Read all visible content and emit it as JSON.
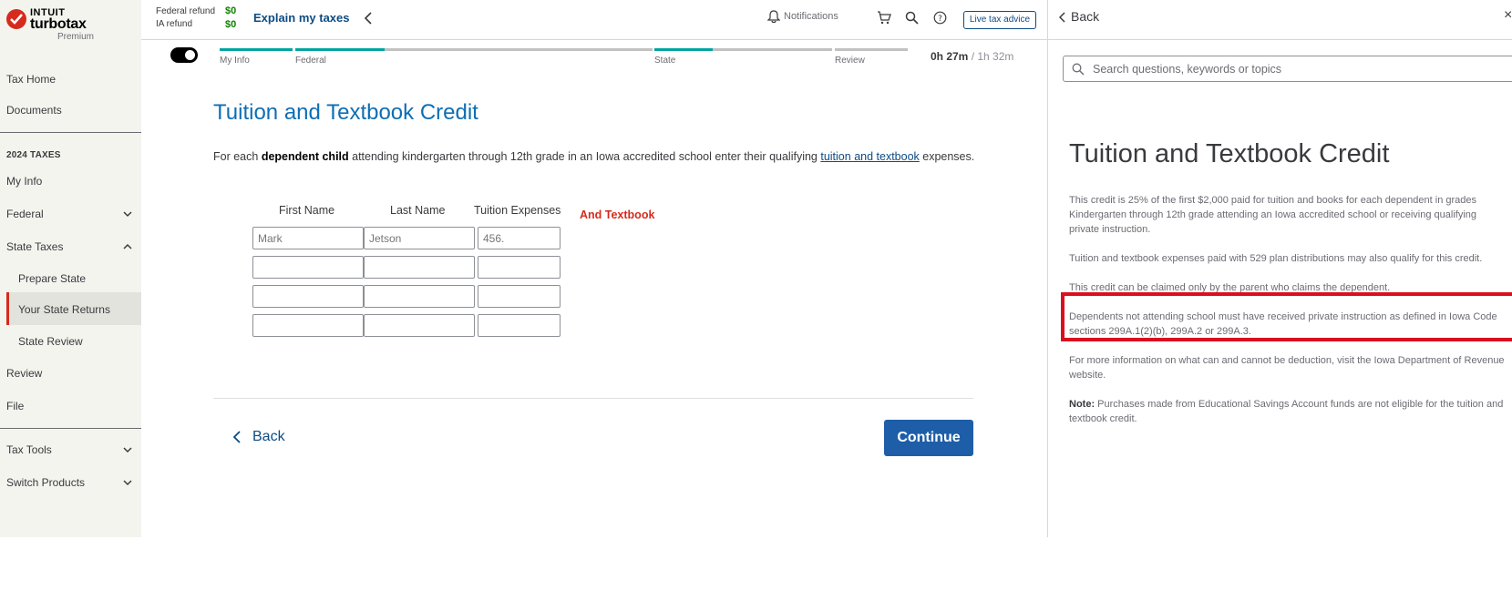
{
  "brand": {
    "intuit": "INTUIT",
    "product": "turbotax",
    "edition": "Premium",
    "accent": "#d52b1e"
  },
  "sidebar": {
    "tax_home": "Tax Home",
    "documents": "Documents",
    "section_title": "2024 TAXES",
    "my_info": "My Info",
    "federal": "Federal",
    "state_taxes": "State Taxes",
    "prepare_state": "Prepare State",
    "your_state_returns": "Your State Returns",
    "state_review": "State Review",
    "review": "Review",
    "file": "File",
    "tax_tools": "Tax Tools",
    "switch_products": "Switch Products"
  },
  "topbar": {
    "federal_refund_label": "Federal refund",
    "federal_refund_value": "$0",
    "ia_refund_label": "IA refund",
    "ia_refund_value": "$0",
    "explain": "Explain my taxes",
    "notifications": "Notifications",
    "live_advice": "Live tax advice"
  },
  "progress": {
    "steps": [
      "My Info",
      "Federal",
      "State",
      "Review"
    ],
    "time_elapsed": "0h 27m",
    "time_total": " / 1h 32m"
  },
  "main": {
    "title": "Tuition and Textbook Credit",
    "intro_prefix": "For each ",
    "intro_bold": "dependent child",
    "intro_mid": " attending kindergarten through 12th grade in an Iowa accredited school enter their qualifying ",
    "intro_link": "tuition and textbook",
    "intro_suffix": " expenses.",
    "columns": [
      "First Name",
      "Last Name",
      "Tuition Expenses"
    ],
    "annotation": "And Textbook",
    "placeholders": {
      "first": "Mark",
      "last": "Jetson",
      "amount": "456."
    },
    "back": "Back",
    "continue": "Continue"
  },
  "help_panel": {
    "back": "Back",
    "close": "×",
    "search_placeholder": "Search questions, keywords or topics",
    "title": "Tuition and Textbook Credit",
    "p1": "This credit is 25% of the first $2,000 paid for tuition and books for each dependent in grades Kindergarten through 12th grade attending an Iowa accredited school or receiving qualifying private instruction.",
    "p2": "Tuition and textbook expenses paid with 529 plan distributions may also qualify for this credit.",
    "p3": "This credit can be claimed only by the parent who claims the dependent.",
    "p4": "Dependents not attending school must have received private instruction as defined in Iowa Code sections 299A.1(2)(b), 299A.2 or 299A.3.",
    "p5": "For more information on what can and cannot be deduction, visit the Iowa Department of Revenue website.",
    "note_label": "Note:",
    "note_text": " Purchases made from Educational Savings Account funds are not eligible for the tuition and textbook credit."
  }
}
